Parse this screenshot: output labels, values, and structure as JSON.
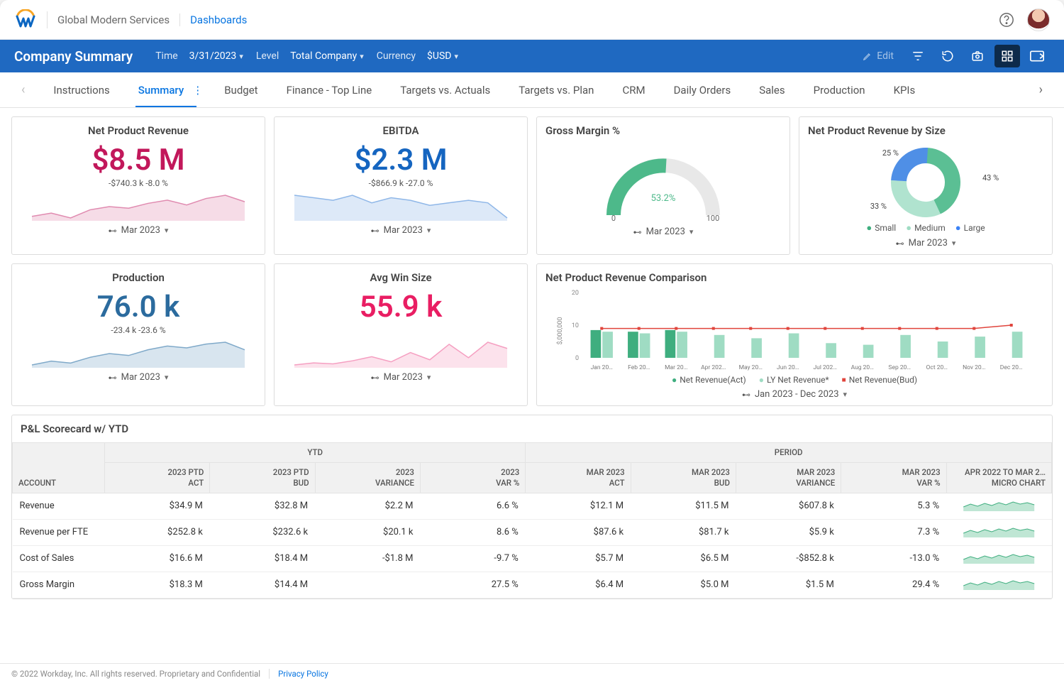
{
  "header": {
    "org": "Global Modern Services",
    "crumb": "Dashboards"
  },
  "bluebar": {
    "title": "Company Summary",
    "filters": {
      "time_label": "Time",
      "time_value": "3/31/2023",
      "level_label": "Level",
      "level_value": "Total Company",
      "currency_label": "Currency",
      "currency_value": "$USD"
    },
    "edit": "Edit"
  },
  "tabs": [
    "Instructions",
    "Summary",
    "Budget",
    "Finance - Top Line",
    "Targets vs. Actuals",
    "Targets vs. Plan",
    "CRM",
    "Daily Orders",
    "Sales",
    "Production",
    "KPIs"
  ],
  "active_tab": "Summary",
  "cards": {
    "npr": {
      "title": "Net Product Revenue",
      "value": "$8.5 M",
      "delta": "-$740.3 k   -8.0 %",
      "period": "Mar 2023"
    },
    "ebitda": {
      "title": "EBITDA",
      "value": "$2.3 M",
      "delta": "-$866.9 k   -27.0 %",
      "period": "Mar 2023"
    },
    "gm": {
      "title": "Gross Margin %",
      "value": "53.2%",
      "min": "0",
      "max": "100",
      "period": "Mar 2023"
    },
    "nprsize": {
      "title": "Net Product Revenue by Size",
      "small": "Small",
      "medium": "Medium",
      "large": "Large",
      "pct_small": "43 %",
      "pct_medium": "33 %",
      "pct_large": "25 %",
      "period": "Mar 2023"
    },
    "prod": {
      "title": "Production",
      "value": "76.0 k",
      "delta": "-23.4 k   -23.6 %",
      "period": "Mar 2023"
    },
    "winsize": {
      "title": "Avg Win Size",
      "value": "55.9 k",
      "period": "Mar 2023"
    },
    "comp": {
      "title": "Net Product Revenue Comparison",
      "ylabel": "$,000,000",
      "legend_a": "Net Revenue(Act)",
      "legend_b": "LY Net Revenue*",
      "legend_c": "Net Revenue(Bud)",
      "period": "Jan 2023 - Dec 2023"
    }
  },
  "scorecard": {
    "title": "P&L Scorecard w/ YTD",
    "group_ytd": "YTD",
    "group_period": "PERIOD",
    "cols": {
      "account": "ACCOUNT",
      "ptd_act": "2023 PTD\nACT",
      "ptd_bud": "2023 PTD\nBUD",
      "var": "2023\nVARIANCE",
      "varpct": "2023\nVAR %",
      "m_act": "MAR 2023\nACT",
      "m_bud": "MAR 2023\nBUD",
      "m_var": "MAR 2023\nVARIANCE",
      "m_varpct": "MAR 2023\nVAR %",
      "micro": "APR 2022 TO MAR 2…\nMICRO CHART"
    },
    "rows": [
      {
        "a": "Revenue",
        "c": [
          "$34.9 M",
          "$32.8 M",
          "$2.2 M",
          "6.6 %",
          "$12.1 M",
          "$11.5 M",
          "$607.8 k",
          "5.3 %"
        ]
      },
      {
        "a": "Revenue per FTE",
        "c": [
          "$252.8 k",
          "$232.6 k",
          "$20.1 k",
          "8.6 %",
          "$87.6 k",
          "$81.7 k",
          "$5.9 k",
          "7.3 %"
        ]
      },
      {
        "a": "Cost of Sales",
        "c": [
          "$16.6 M",
          "$18.4 M",
          "-$1.8 M",
          "-9.7 %",
          "$5.7 M",
          "$6.5 M",
          "-$852.8 k",
          "-13.0 %"
        ]
      },
      {
        "a": "Gross Margin",
        "c": [
          "$18.3 M",
          "$14.4 M",
          "",
          "27.5 %",
          "$6.4 M",
          "$5.0 M",
          "$1.5 M",
          "29.4 %"
        ]
      }
    ]
  },
  "footer": {
    "copyright": "© 2022 Workday, Inc. All rights reserved. Proprietary and Confidential",
    "privacy": "Privacy Policy"
  },
  "chart_data": [
    {
      "id": "npr_spark",
      "type": "area",
      "title": "Net Product Revenue trend",
      "color": "#e08bb0",
      "values": [
        7.6,
        7.8,
        7.5,
        8.0,
        8.2,
        8.1,
        8.4,
        8.6,
        8.3,
        8.7,
        8.9,
        8.5
      ]
    },
    {
      "id": "ebitda_spark",
      "type": "area",
      "title": "EBITDA trend",
      "color": "#8fb7e8",
      "values": [
        2.9,
        2.8,
        2.7,
        2.9,
        2.6,
        2.8,
        2.7,
        2.5,
        2.6,
        2.7,
        2.6,
        2.0
      ]
    },
    {
      "id": "prod_spark",
      "type": "area",
      "title": "Production trend",
      "color": "#7fa9c9",
      "values": [
        68,
        70,
        69,
        72,
        74,
        73,
        76,
        78,
        77,
        79,
        80,
        76
      ]
    },
    {
      "id": "win_spark",
      "type": "area",
      "title": "Avg Win Size trend",
      "color": "#f59fc1",
      "values": [
        40,
        42,
        41,
        44,
        48,
        43,
        52,
        45,
        60,
        47,
        62,
        56
      ]
    },
    {
      "id": "gross_margin_gauge",
      "type": "gauge",
      "value": 53.2,
      "min": 0,
      "max": 100
    },
    {
      "id": "npr_by_size",
      "type": "pie",
      "title": "Net Product Revenue by Size",
      "series": [
        {
          "name": "Small",
          "value": 43,
          "color": "#5bbf94"
        },
        {
          "name": "Medium",
          "value": 33,
          "color": "#b0e3cf"
        },
        {
          "name": "Large",
          "value": 25,
          "color": "#4f8fe6"
        }
      ]
    },
    {
      "id": "npr_comparison",
      "type": "bar",
      "title": "Net Product Revenue Comparison",
      "ylabel": "$,000,000",
      "ylim": [
        0,
        20
      ],
      "categories": [
        "Jan 20…",
        "Feb 20…",
        "Mar 20…",
        "Apr 202…",
        "May 20…",
        "Jun 20…",
        "Jul 202…",
        "Aug 20…",
        "Sep 20…",
        "Oct 20…",
        "Nov 20…",
        "Dec 20…"
      ],
      "series": [
        {
          "name": "Net Revenue(Act)",
          "type": "bar",
          "color": "#3fae7f",
          "values": [
            8.5,
            8.0,
            8.5,
            0,
            0,
            0,
            0,
            0,
            0,
            0,
            0,
            0
          ]
        },
        {
          "name": "LY Net Revenue*",
          "type": "bar",
          "color": "#9fdcc3",
          "values": [
            8.0,
            7.5,
            8.0,
            7.0,
            6.0,
            7.5,
            4.5,
            4.0,
            7.0,
            5.0,
            6.5,
            8.0
          ]
        },
        {
          "name": "Net Revenue(Bud)",
          "type": "line",
          "color": "#e0443c",
          "values": [
            9,
            9,
            9,
            9,
            9,
            9,
            9,
            9,
            9,
            9,
            9,
            10
          ]
        }
      ]
    }
  ]
}
